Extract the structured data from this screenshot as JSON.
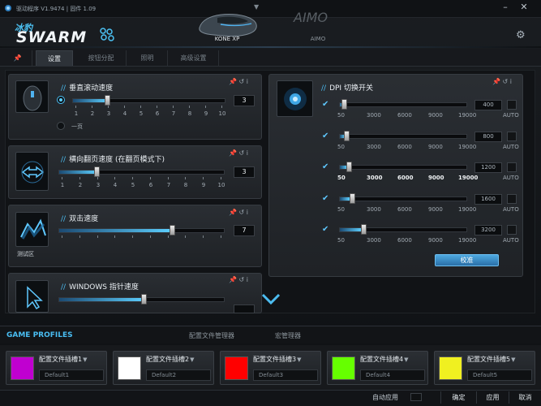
{
  "titlebar": {
    "app_name": "驱动程序 V1.9474 | 固件 1.09"
  },
  "header": {
    "logo_cn": "冰豹",
    "logo_en": "SWARM",
    "devices": [
      {
        "label": "KONE XP",
        "logo": ""
      },
      {
        "label": "AIMO",
        "logo": "AIMO"
      }
    ]
  },
  "tabs": [
    "设置",
    "按钮分配",
    "照明",
    "高级设置"
  ],
  "panels": {
    "vscroll": {
      "title": "垂直滚动速度",
      "value": "3",
      "ticks": [
        "1",
        "2",
        "3",
        "4",
        "5",
        "6",
        "7",
        "8",
        "9",
        "10"
      ],
      "option_label": "一页"
    },
    "hscroll": {
      "title": "横向翻页速度 (在翻页模式下)",
      "value": "3",
      "ticks": [
        "1",
        "2",
        "3",
        "4",
        "5",
        "6",
        "7",
        "8",
        "9",
        "10"
      ]
    },
    "dblclick": {
      "title": "双击速度",
      "value": "7",
      "test_label": "测试区"
    },
    "pointer": {
      "title": "WINDOWS 指针速度"
    },
    "dpi": {
      "title": "DPI 切换开关",
      "scale": [
        "50",
        "3000",
        "6000",
        "9000",
        "19000"
      ],
      "auto_label": "AUTO",
      "rows": [
        {
          "value": "400",
          "level": 0.02
        },
        {
          "value": "800",
          "level": 0.04
        },
        {
          "value": "1200",
          "level": 0.06
        },
        {
          "value": "1600",
          "level": 0.08
        },
        {
          "value": "3200",
          "level": 0.17
        }
      ],
      "apply_label": "校准"
    }
  },
  "profiles": {
    "header": "GAME PROFILES",
    "tabs": [
      "配置文件管理器",
      "宏管理器"
    ],
    "items": [
      {
        "name": "配置文件插槽1",
        "default": "Default1",
        "color": "#c000d0"
      },
      {
        "name": "配置文件插槽2",
        "default": "Default2",
        "color": "#ffffff"
      },
      {
        "name": "配置文件插槽3",
        "default": "Default3",
        "color": "#ff0000"
      },
      {
        "name": "配置文件插槽4",
        "default": "Default4",
        "color": "#66ff00"
      },
      {
        "name": "配置文件插槽5",
        "default": "Default5",
        "color": "#f0f020"
      }
    ]
  },
  "bottom": {
    "auto_apply": "自动应用",
    "ok": "确定",
    "apply": "应用",
    "cancel": "取消"
  }
}
